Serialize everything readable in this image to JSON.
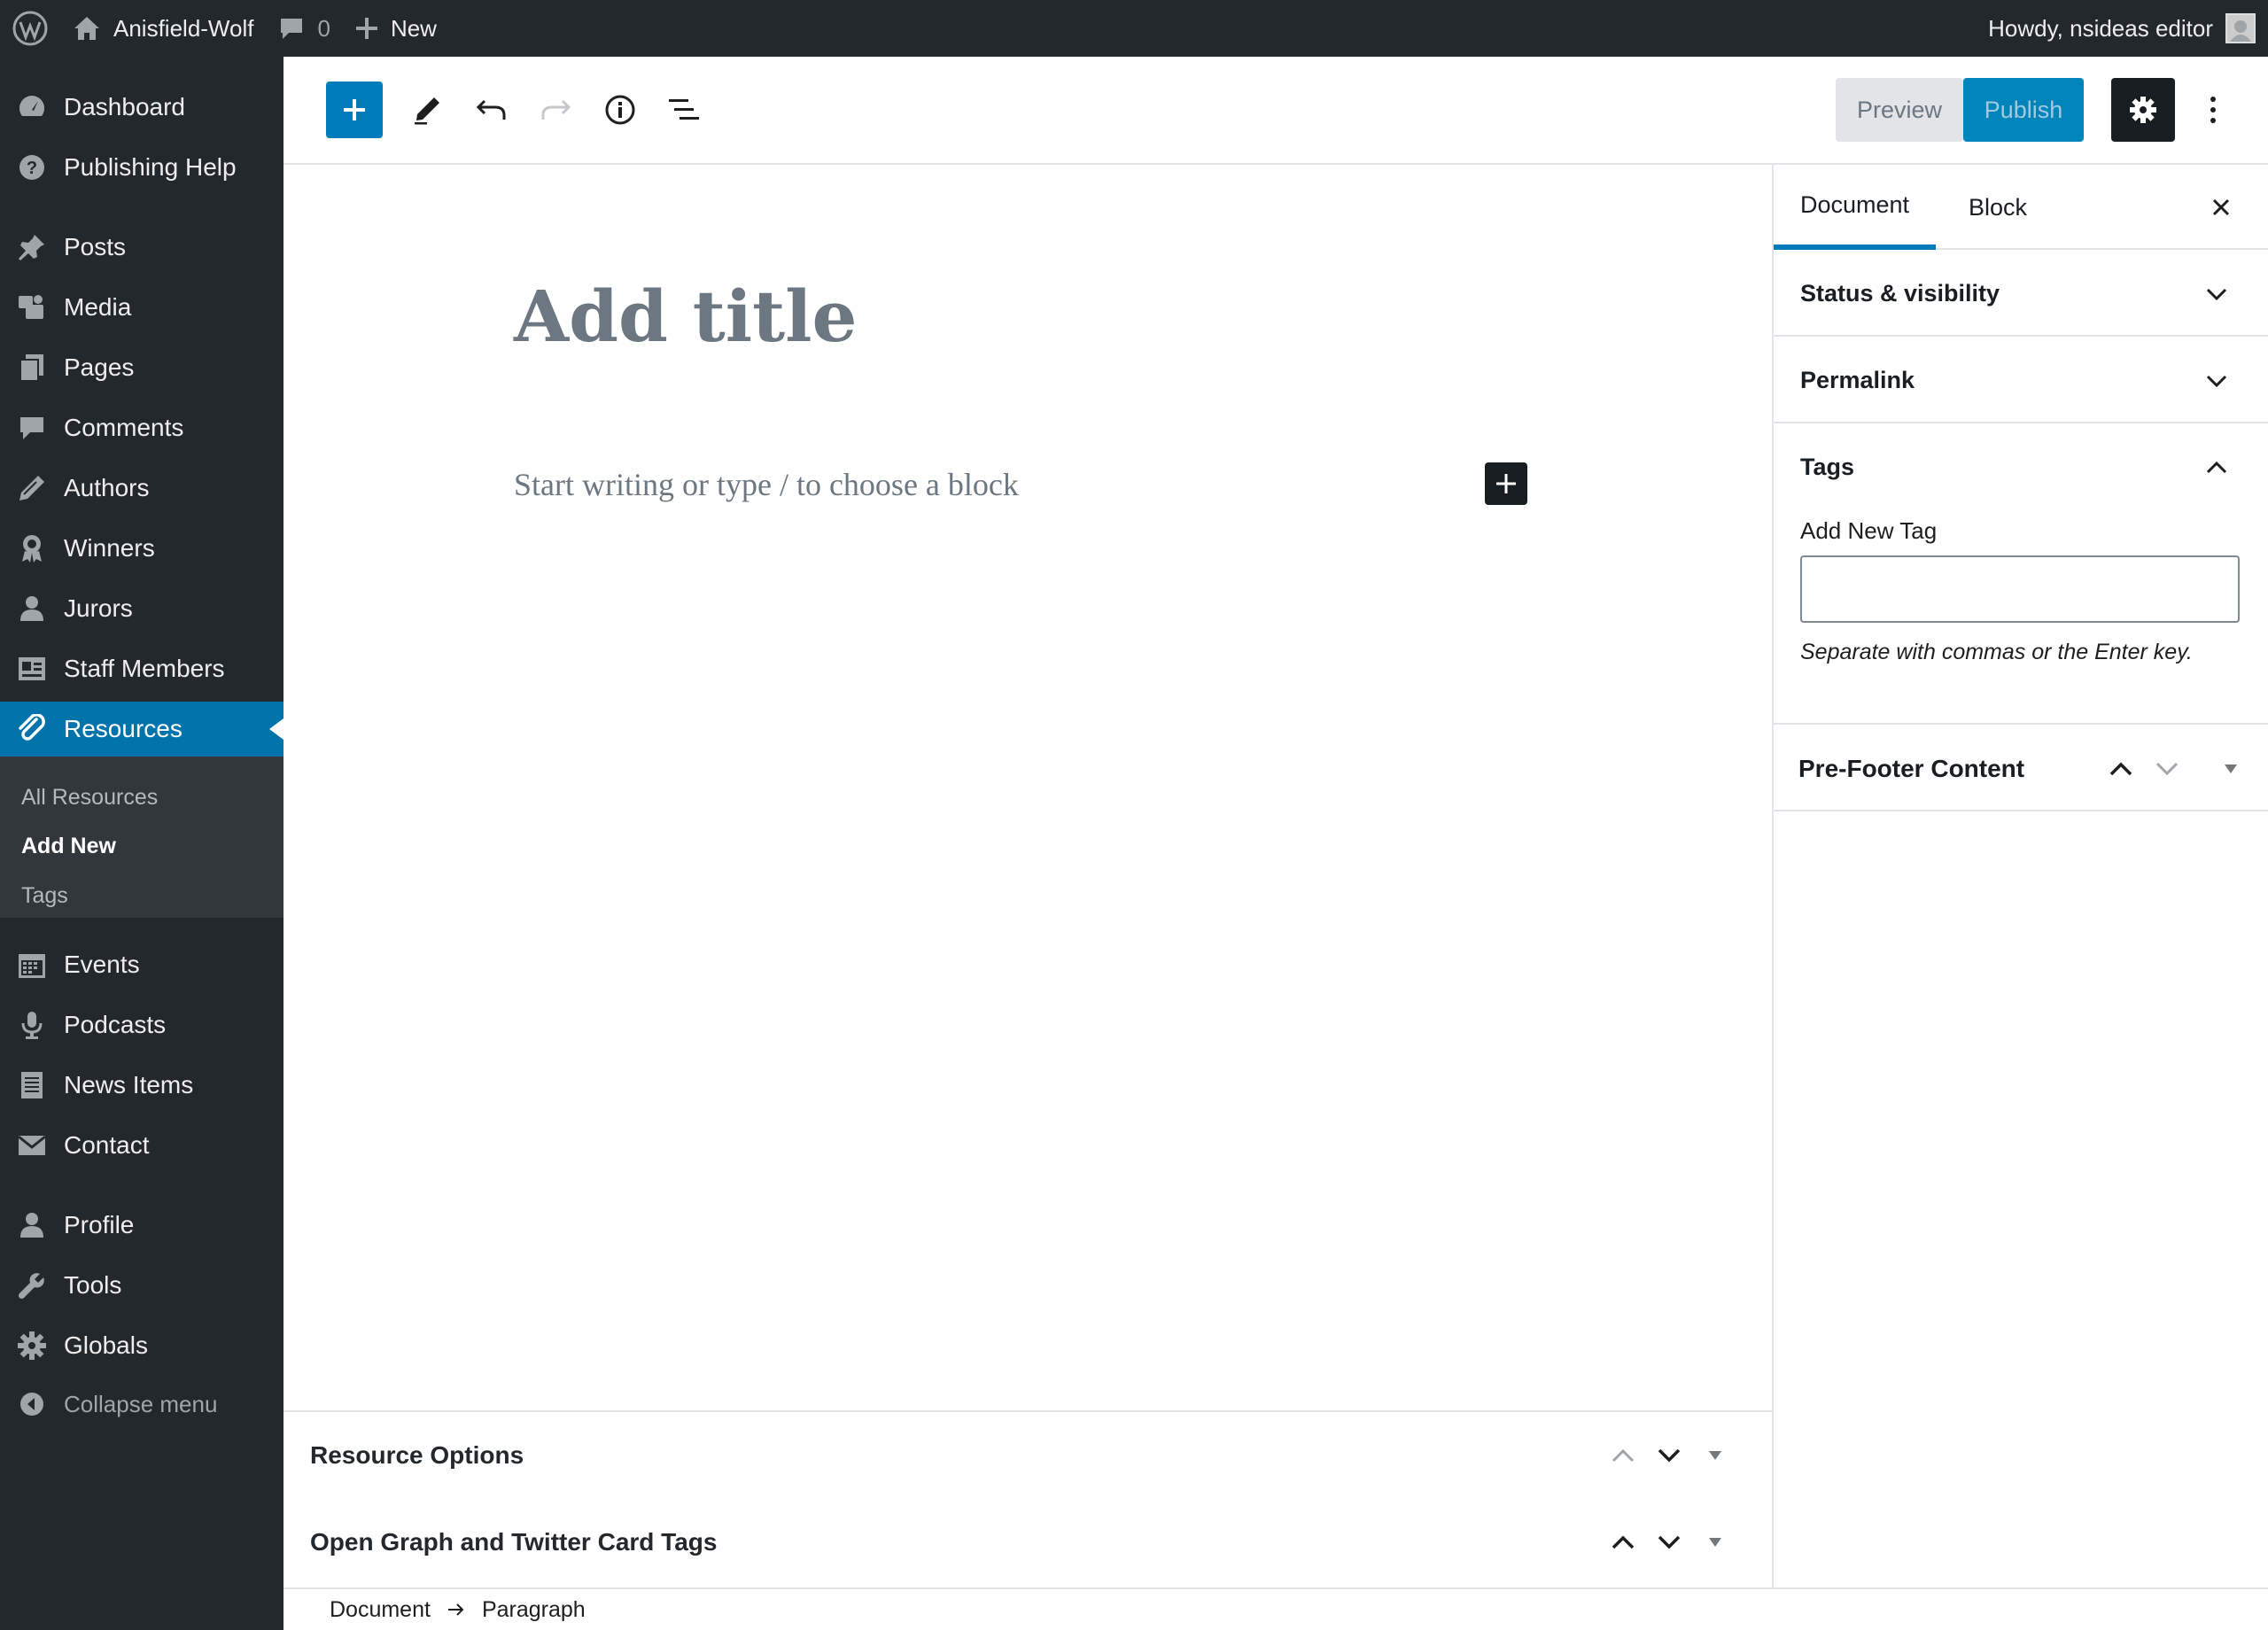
{
  "admin_bar": {
    "site_name": "Anisfield-Wolf",
    "comment_count": "0",
    "new_label": "New",
    "greeting": "Howdy, nsideas editor"
  },
  "menu": {
    "items": [
      {
        "label": "Dashboard",
        "icon": "dashboard-icon"
      },
      {
        "label": "Publishing Help",
        "icon": "help-icon"
      },
      {
        "label": "Posts",
        "icon": "pin-icon"
      },
      {
        "label": "Media",
        "icon": "media-icon"
      },
      {
        "label": "Pages",
        "icon": "pages-icon"
      },
      {
        "label": "Comments",
        "icon": "comment-icon"
      },
      {
        "label": "Authors",
        "icon": "pencil-icon"
      },
      {
        "label": "Winners",
        "icon": "award-icon"
      },
      {
        "label": "Jurors",
        "icon": "person-icon"
      },
      {
        "label": "Staff Members",
        "icon": "id-card-icon"
      },
      {
        "label": "Resources",
        "icon": "paperclip-icon"
      },
      {
        "label": "Events",
        "icon": "calendar-icon"
      },
      {
        "label": "Podcasts",
        "icon": "microphone-icon"
      },
      {
        "label": "News Items",
        "icon": "document-icon"
      },
      {
        "label": "Contact",
        "icon": "envelope-icon"
      },
      {
        "label": "Profile",
        "icon": "person-icon"
      },
      {
        "label": "Tools",
        "icon": "wrench-icon"
      },
      {
        "label": "Globals",
        "icon": "gear-icon"
      },
      {
        "label": "Collapse menu",
        "icon": "collapse-icon"
      }
    ],
    "submenu": [
      "All Resources",
      "Add New",
      "Tags"
    ]
  },
  "toolbar": {
    "preview_label": "Preview",
    "publish_label": "Publish"
  },
  "editor": {
    "title_placeholder": "Add title",
    "block_placeholder": "Start writing or type / to choose a block"
  },
  "sidebar": {
    "tabs": [
      "Document",
      "Block"
    ],
    "panels": {
      "status": "Status & visibility",
      "permalink": "Permalink",
      "tags": "Tags",
      "prefooter": "Pre-Footer Content"
    },
    "tag_label": "Add New Tag",
    "tag_value": "",
    "tag_help": "Separate with commas or the Enter key."
  },
  "metaboxes": [
    "Resource Options",
    "Open Graph and Twitter Card Tags"
  ],
  "breadcrumb": [
    "Document",
    "Paragraph"
  ],
  "colors": {
    "admin_dark": "#23282d",
    "accent_blue": "#0073aa",
    "publish_blue": "#0085ba",
    "submenu_bg": "#32373c"
  }
}
